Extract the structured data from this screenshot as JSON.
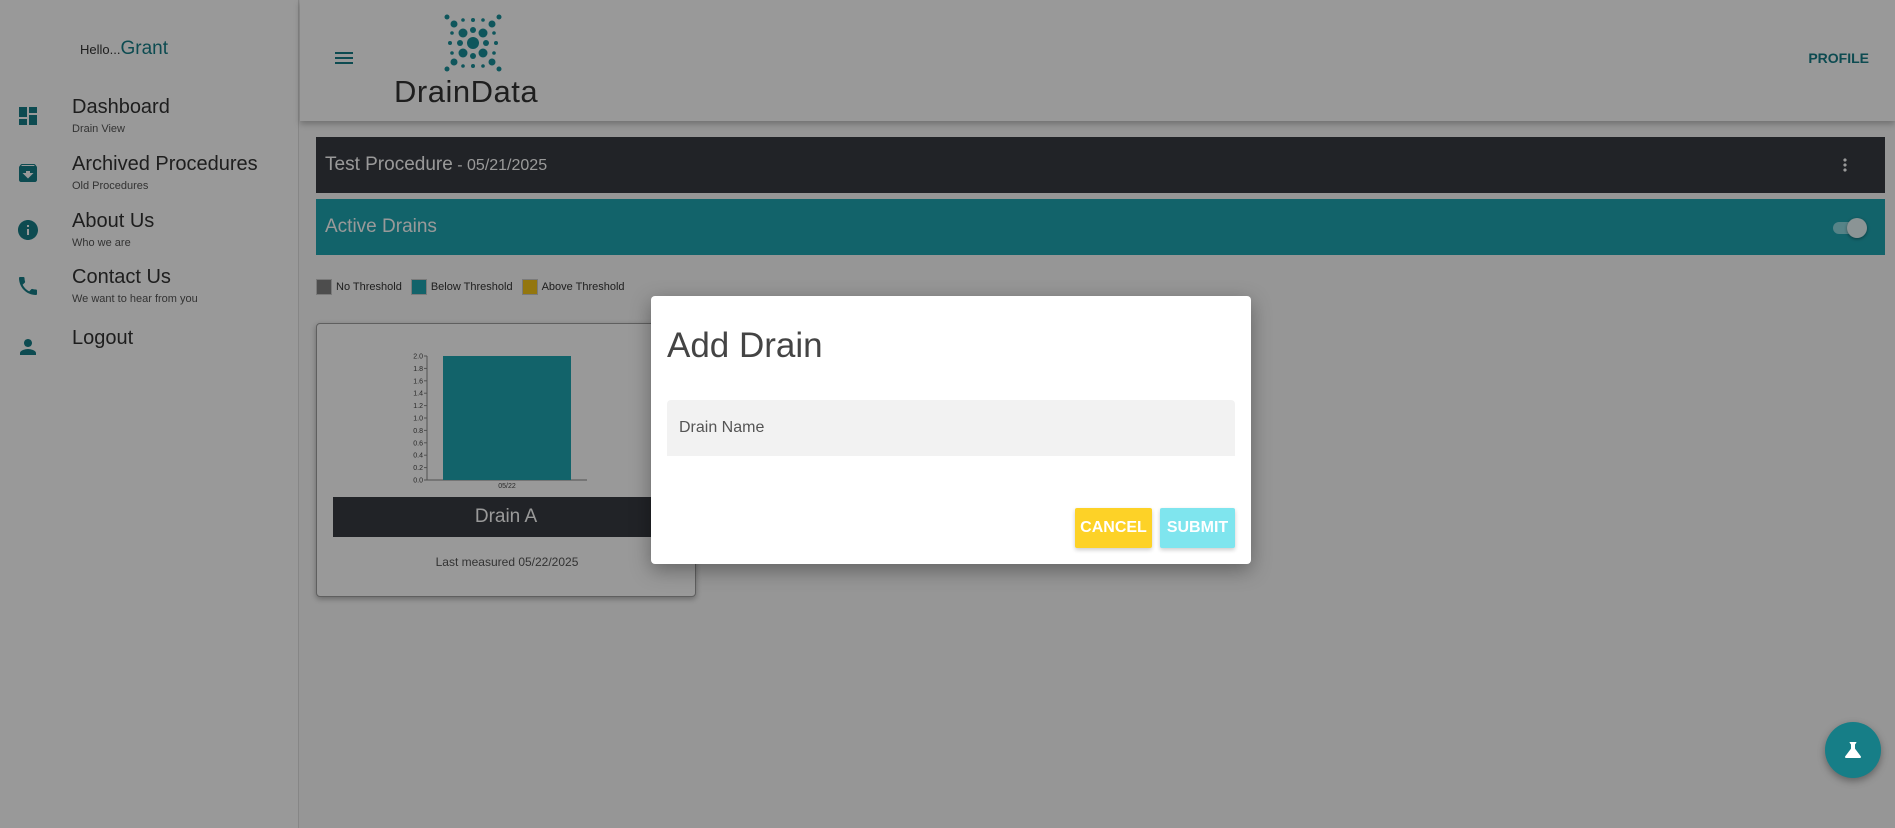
{
  "sidebar": {
    "greeting": "Hello...",
    "user_name": "Grant",
    "items": [
      {
        "title": "Dashboard",
        "subtitle": "Drain View",
        "icon": "dashboard-icon"
      },
      {
        "title": "Archived Procedures",
        "subtitle": "Old Procedures",
        "icon": "archive-icon"
      },
      {
        "title": "About Us",
        "subtitle": "Who we are",
        "icon": "info-icon"
      },
      {
        "title": "Contact Us",
        "subtitle": "We want to hear from you",
        "icon": "phone-icon"
      },
      {
        "title": "Logout",
        "subtitle": "",
        "icon": "person-icon"
      }
    ]
  },
  "header": {
    "logo_text": "DrainData",
    "profile_label": "PROFILE"
  },
  "procedure": {
    "title": "Test Procedure",
    "date": " - 05/21/2025"
  },
  "active_drains": {
    "title": "Active Drains",
    "toggle_on": true
  },
  "legend": [
    {
      "label": "No Threshold",
      "color": "#808080"
    },
    {
      "label": "Below Threshold",
      "color": "#1fa5b1"
    },
    {
      "label": "Above Threshold",
      "color": "#f5c518"
    }
  ],
  "drain_card": {
    "name": "Drain A",
    "last_measured": "Last measured 05/22/2025"
  },
  "chart_data": {
    "type": "bar",
    "categories": [
      "05/22"
    ],
    "values": [
      2.0
    ],
    "ylim": [
      0,
      2.0
    ],
    "yticks": [
      "0.0",
      "0.2",
      "0.4",
      "0.6",
      "0.8",
      "1.0",
      "1.2",
      "1.4",
      "1.6",
      "1.8",
      "2.0"
    ],
    "bar_color": "#1fa5b1"
  },
  "dialog": {
    "title": "Add Drain",
    "field_placeholder": "Drain Name",
    "field_value": "",
    "cancel_label": "CANCEL",
    "submit_label": "SUBMIT"
  },
  "colors": {
    "accent": "#167e87",
    "teal": "#1fa5b1",
    "dark_bar": "#373b42",
    "cancel": "#fdd227",
    "submit": "#7fe5ee"
  },
  "fab": {
    "icon": "flask-icon"
  }
}
